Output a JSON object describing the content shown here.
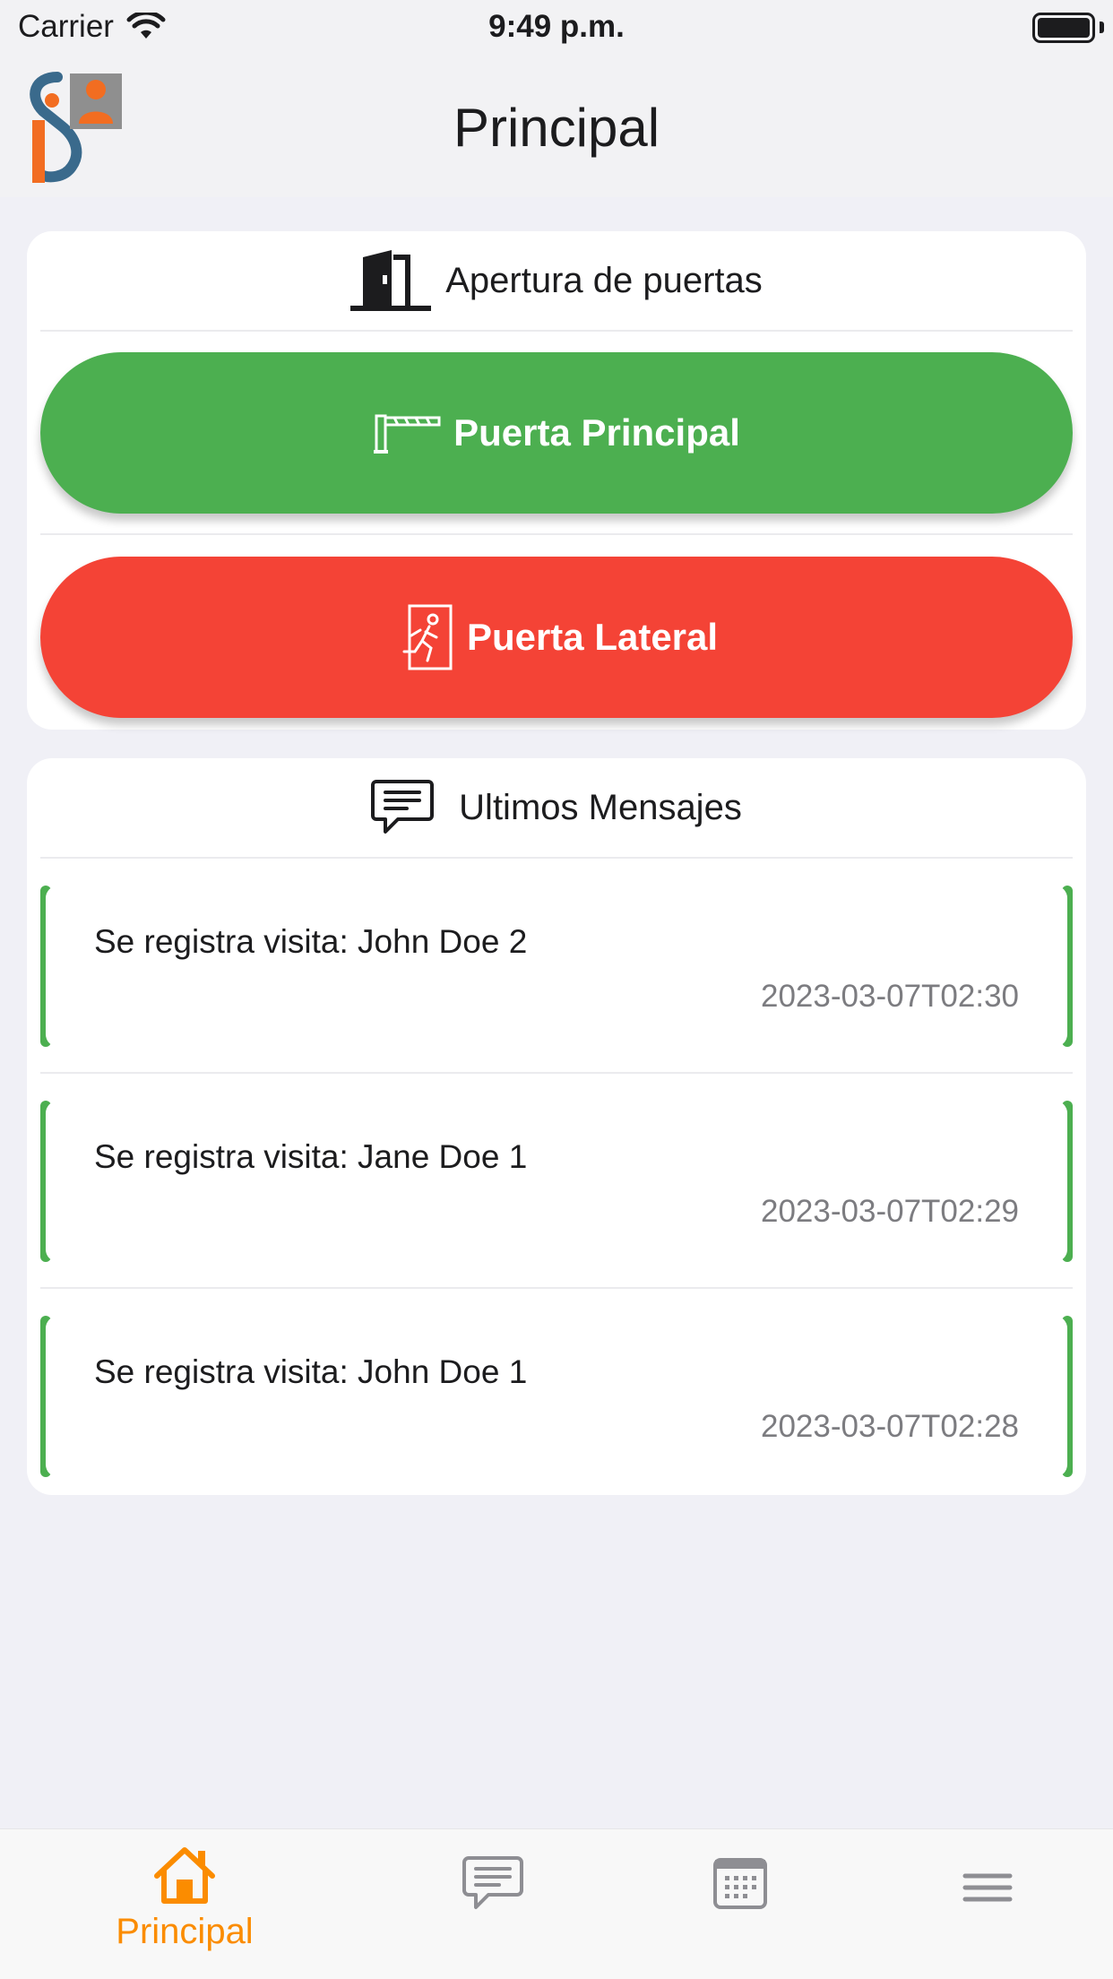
{
  "status_bar": {
    "carrier": "Carrier",
    "time": "9:49 p.m."
  },
  "header": {
    "title": "Principal"
  },
  "doors_card": {
    "title": "Apertura de puertas",
    "buttons": [
      {
        "label": "Puerta Principal",
        "color": "#4caf50",
        "icon": "barrier-gate-icon"
      },
      {
        "label": "Puerta Lateral",
        "color": "#f44336",
        "icon": "emergency-exit-icon"
      }
    ]
  },
  "messages_card": {
    "title": "Ultimos Mensajes",
    "items": [
      {
        "text": "Se registra visita: John Doe 2",
        "date": "2023-03-07T02:30"
      },
      {
        "text": "Se registra visita: Jane Doe 1",
        "date": "2023-03-07T02:29"
      },
      {
        "text": "Se registra visita: John Doe 1",
        "date": "2023-03-07T02:28"
      }
    ]
  },
  "tab_bar": {
    "tabs": [
      {
        "label": "Principal",
        "icon": "home-icon",
        "active": true
      },
      {
        "label": "",
        "icon": "messages-icon",
        "active": false
      },
      {
        "label": "",
        "icon": "calendar-icon",
        "active": false
      },
      {
        "label": "",
        "icon": "menu-icon",
        "active": false
      }
    ]
  },
  "colors": {
    "accent": "#fb8c00",
    "success": "#4caf50",
    "danger": "#f44336",
    "background": "#f0f0f6"
  }
}
